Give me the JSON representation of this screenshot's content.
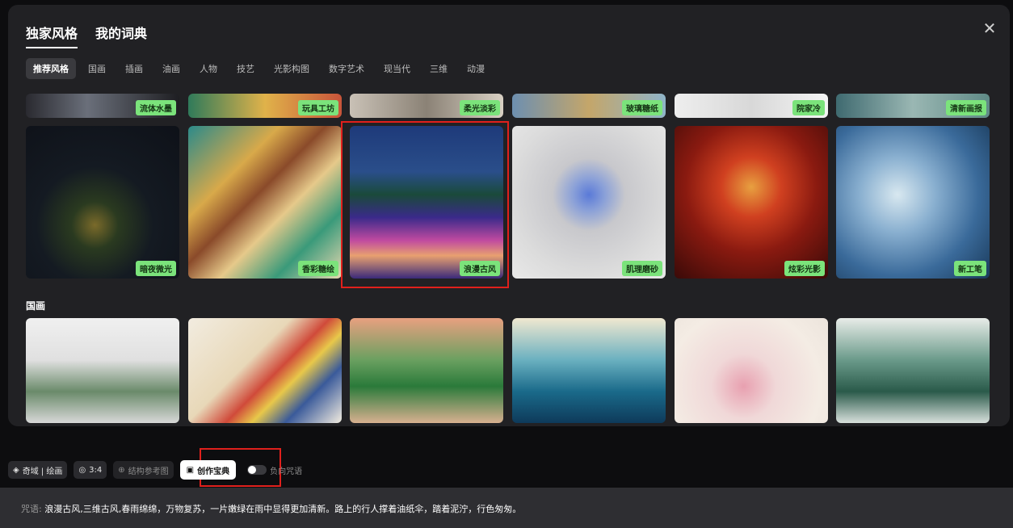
{
  "top_tabs": [
    {
      "label": "独家风格",
      "active": true
    },
    {
      "label": "我的词典",
      "active": false
    }
  ],
  "close_label": "✕",
  "categories": [
    "推荐风格",
    "国画",
    "插画",
    "油画",
    "人物",
    "技艺",
    "光影构图",
    "数字艺术",
    "现当代",
    "三维",
    "动漫"
  ],
  "top_row_tags": [
    "流体水墨",
    "玩具工坊",
    "柔光淡彩",
    "玻璃糖纸",
    "院家冷",
    "清新画报"
  ],
  "main_row": [
    {
      "tag": "暗夜微光",
      "icon": "night-glow-image"
    },
    {
      "tag": "香彩糖绘",
      "icon": "candy-paint-image"
    },
    {
      "tag": "浪漫古风",
      "icon": "romantic-ancient-image"
    },
    {
      "tag": "肌理磨砂",
      "icon": "matte-texture-image"
    },
    {
      "tag": "炫彩光影",
      "icon": "colorful-light-image"
    },
    {
      "tag": "新工笔",
      "icon": "new-gongbi-image"
    }
  ],
  "section_title": "国画",
  "toolbar": {
    "model": "奇域 | 绘画",
    "ratio": "3:4",
    "struct_ref": "结构参考图",
    "creation_book": "创作宝典",
    "negative": "负向咒语"
  },
  "prompt": {
    "label": "咒语: ",
    "text": "浪漫古风,三维古风,春雨绵绵，万物复苏，一片嫩绿在雨中显得更加清新。路上的行人撑着油纸伞，踏着泥泞，行色匆匆。"
  },
  "colors": {
    "accent_tag": "#7be37b",
    "highlight": "#e0201c",
    "modal_bg": "#212124"
  }
}
